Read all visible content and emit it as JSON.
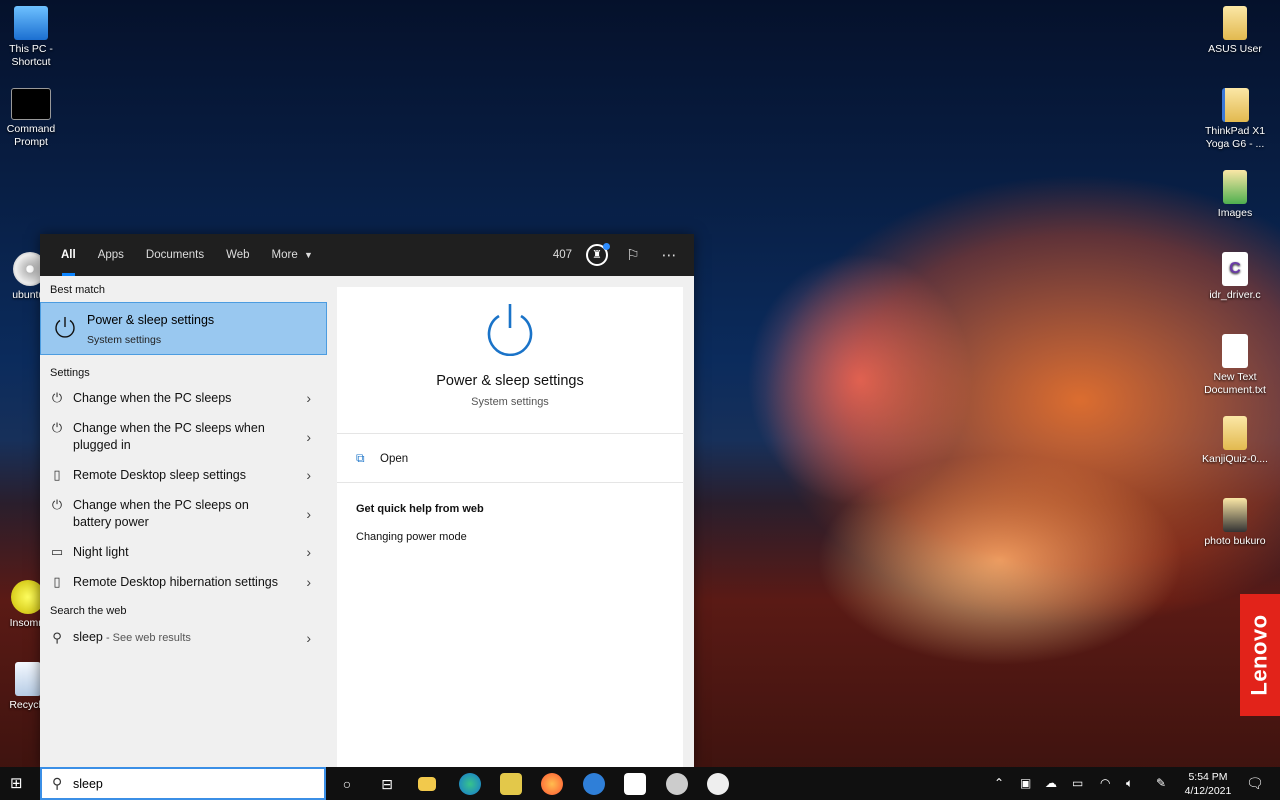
{
  "desktop": {
    "icons_left": [
      {
        "label": "This PC - Shortcut",
        "icon": "computer-icon",
        "color": "#2a8fe0"
      },
      {
        "label": "Command Prompt",
        "icon": "terminal-icon",
        "color": "#111111"
      },
      {
        "label": "ubuntu-",
        "icon": "disc-icon",
        "color": "#c8c8c8"
      },
      {
        "label": "Insomni",
        "icon": "coin-icon",
        "color": "#e8e030"
      },
      {
        "label": "Recycle",
        "icon": "recycle-bin-icon",
        "color": "#dfe8f2"
      }
    ],
    "icons_right": [
      {
        "label": "ASUS User",
        "icon": "folder-icon",
        "color": "#f0d27a"
      },
      {
        "label": "ThinkPad X1 Yoga G6 - ...",
        "icon": "folder-icon",
        "color": "#f0d27a"
      },
      {
        "label": "Images",
        "icon": "folder-icon",
        "color": "#f0d27a"
      },
      {
        "label": "idr_driver.c",
        "icon": "c-file-icon",
        "color": "#ffffff"
      },
      {
        "label": "New Text Document.txt",
        "icon": "text-file-icon",
        "color": "#ffffff"
      },
      {
        "label": "KanjiQuiz-0....",
        "icon": "folder-icon",
        "color": "#f0d27a"
      },
      {
        "label": "photo bukuro",
        "icon": "folder-icon",
        "color": "#f0d27a"
      }
    ],
    "brand": "Lenovo"
  },
  "search": {
    "tabs": [
      "All",
      "Apps",
      "Documents",
      "Web",
      "More"
    ],
    "active_tab": "All",
    "points": "407",
    "best_match_header": "Best match",
    "best_match": {
      "title": "Power & sleep settings",
      "subtitle": "System settings"
    },
    "settings_header": "Settings",
    "settings_items": [
      {
        "label": "Change when the PC sleeps",
        "icon": "power-icon"
      },
      {
        "label": "Change when the PC sleeps when plugged in",
        "icon": "power-icon"
      },
      {
        "label": "Remote Desktop sleep settings",
        "icon": "remote-desktop-icon"
      },
      {
        "label": "Change when the PC sleeps on battery power",
        "icon": "power-icon"
      },
      {
        "label": "Night light",
        "icon": "monitor-icon"
      },
      {
        "label": "Remote Desktop hibernation settings",
        "icon": "remote-desktop-icon"
      }
    ],
    "web_header": "Search the web",
    "web_query": "sleep",
    "web_suffix": " - See web results",
    "query": "sleep"
  },
  "preview": {
    "title": "Power & sleep settings",
    "subtitle": "System settings",
    "open_label": "Open",
    "help_header": "Get quick help from web",
    "help_link": "Changing power mode"
  },
  "taskbar": {
    "time": "5:54 PM",
    "date": "4/12/2021"
  },
  "colors": {
    "accent": "#0a84ff",
    "selection": "#99c8f0",
    "power_blue": "#1a73c8"
  }
}
